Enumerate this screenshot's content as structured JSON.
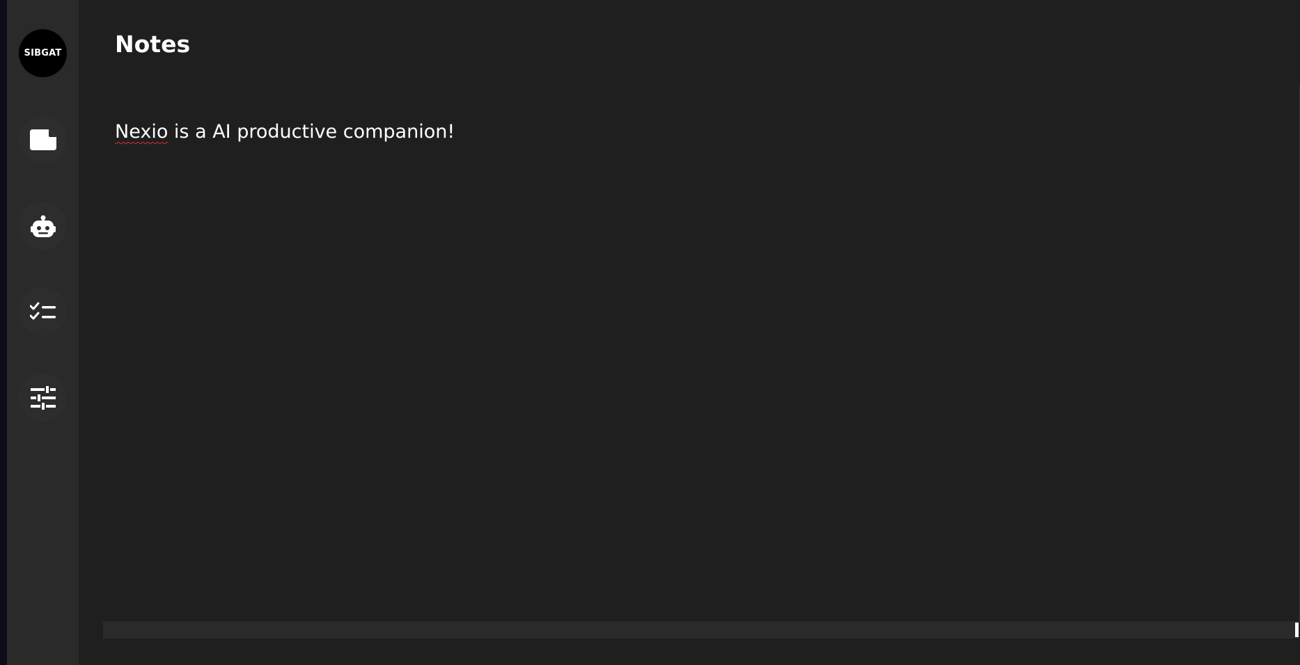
{
  "sidebar": {
    "avatar_label": "SIBGAT",
    "items": [
      {
        "icon": "note-icon"
      },
      {
        "icon": "robot-icon"
      },
      {
        "icon": "checklist-icon"
      },
      {
        "icon": "sliders-icon"
      }
    ]
  },
  "main": {
    "title": "Notes",
    "note_text_misspelled": "Nexio",
    "note_text_rest": " is a AI productive companion!"
  },
  "colors": {
    "sidebar_bg": "#2a2a2a",
    "main_bg": "#1f1f1f",
    "text": "#ffffff",
    "spellcheck": "#e03030"
  }
}
